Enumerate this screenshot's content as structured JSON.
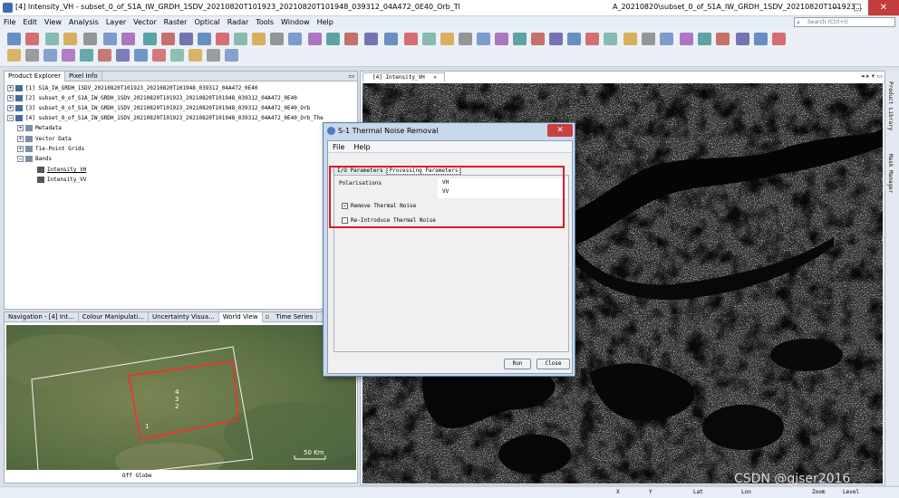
{
  "window": {
    "title": "[4] Intensity_VH - subset_0_of_S1A_IW_GRDH_1SDV_20210820T101923_20210820T101948_039312_04A472_0E40_Orb_Tl",
    "title_right": "A_20210820\\subset_0_of_S1A_IW_GRDH_1SDV_20210820T101923...",
    "minimize": "—",
    "maximize": "□",
    "close": "✕"
  },
  "menu": [
    "File",
    "Edit",
    "View",
    "Analysis",
    "Layer",
    "Vector",
    "Raster",
    "Optical",
    "Radar",
    "Tools",
    "Window",
    "Help"
  ],
  "search": {
    "placeholder": "Search (Ctrl+I)"
  },
  "product_explorer": {
    "tabs": [
      "Product Explorer",
      "Pixel Info"
    ],
    "products": [
      "[1] S1A_IW_GRDH_1SDV_20210820T101923_20210820T101948_039312_04A472_0E40",
      "[2] subset_0_of_S1A_IW_GRDH_1SDV_20210820T101923_20210820T101948_039312_04A472_0E40",
      "[3] subset_0_of_S1A_IW_GRDH_1SDV_20210820T101923_20210820T101948_039312_04A472_0E40_Orb",
      "[4] subset_0_of_S1A_IW_GRDH_1SDV_20210820T101923_20210820T101948_039312_04A472_0E40_Orb_The"
    ],
    "nodes": [
      "Metadata",
      "Vector Data",
      "Tie-Point Grids",
      "Bands"
    ],
    "bands": [
      "Intensity_VH",
      "Intensity_VV"
    ]
  },
  "bottom_panel": {
    "tabs": [
      "Navigation - [4] Int...",
      "Colour Manipulati...",
      "Uncertainty Visua...",
      "World View",
      "Time Series"
    ],
    "scale_label": "50 Km",
    "globe_label": "Off Globe",
    "footprint_labels": [
      "4",
      "3",
      "2",
      "1"
    ]
  },
  "image_window": {
    "tab_label": "[4] Intensity_VH"
  },
  "right_strip": [
    "Product Library",
    "Mask Manager"
  ],
  "status_bar": {
    "x": "X",
    "y": "Y",
    "lat": "Lat",
    "lon": "Lon",
    "zoom": "Zoom",
    "level": "Level"
  },
  "dialog": {
    "title": "S-1 Thermal Noise Removal",
    "menu": [
      "File",
      "Help"
    ],
    "tabs": [
      "I/O Parameters",
      "Processing Parameters"
    ],
    "polarisations_label": "Polarisations",
    "polarisations": [
      "VH",
      "VV"
    ],
    "remove_thermal_noise": {
      "label": "Remove Thermal Noise",
      "checked": true
    },
    "reintroduce_thermal_noise": {
      "label": "Re-Introduce Thermal Noise",
      "checked": false
    },
    "run_label": "Run",
    "close_label": "Close"
  },
  "watermark": "CSDN @gjser2016",
  "colors": {
    "highlight_box": "#e0152a",
    "footprint": "#ff2a2a"
  }
}
